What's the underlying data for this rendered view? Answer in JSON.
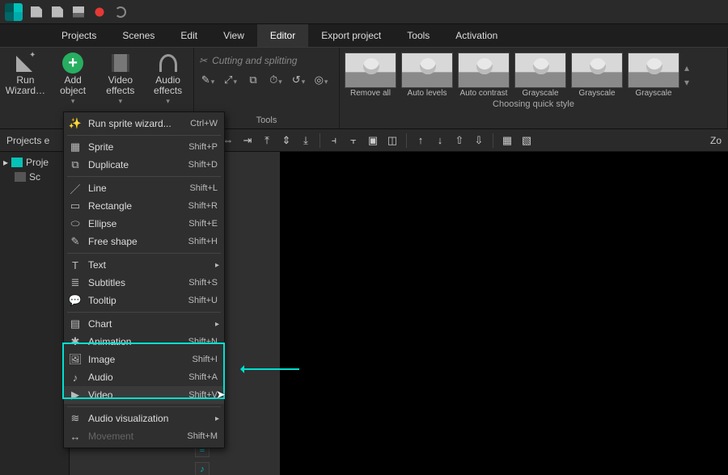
{
  "titlebar": {
    "icons": [
      "new-file-icon",
      "open-file-icon",
      "save-icon",
      "record-icon",
      "redo-icon"
    ]
  },
  "menubar": {
    "items": [
      "Projects",
      "Scenes",
      "Edit",
      "View",
      "Editor",
      "Export project",
      "Tools",
      "Activation"
    ],
    "active_index": 4
  },
  "ribbon": {
    "edit": {
      "run_wizard": "Run Wizard…",
      "add_object": "Add object",
      "video_effects": "Video effects",
      "audio_effects": "Audio effects"
    },
    "tools": {
      "top_label": "Cutting and splitting",
      "caption": "Tools"
    },
    "styles": {
      "caption": "Choosing quick style",
      "thumbs": [
        "Remove all",
        "Auto levels",
        "Auto contrast",
        "Grayscale",
        "Grayscale",
        "Grayscale"
      ]
    }
  },
  "panel_title": "Projects e",
  "tree": {
    "root": "Proje",
    "child": "Sc"
  },
  "toolbar2_zoom": "Zo",
  "ctx_menu": {
    "items": [
      {
        "icon": "wand-icon",
        "label": "Run sprite wizard...",
        "shortcut": "Ctrl+W",
        "interact": true
      },
      {
        "sep": true
      },
      {
        "icon": "sprite-icon",
        "label": "Sprite",
        "shortcut": "Shift+P",
        "interact": true
      },
      {
        "icon": "duplicate-icon",
        "label": "Duplicate",
        "shortcut": "Shift+D",
        "interact": true
      },
      {
        "sep": true
      },
      {
        "icon": "line-icon",
        "label": "Line",
        "shortcut": "Shift+L",
        "interact": true
      },
      {
        "icon": "rectangle-icon",
        "label": "Rectangle",
        "shortcut": "Shift+R",
        "interact": true
      },
      {
        "icon": "ellipse-icon",
        "label": "Ellipse",
        "shortcut": "Shift+E",
        "interact": true
      },
      {
        "icon": "freeshape-icon",
        "label": "Free shape",
        "shortcut": "Shift+H",
        "interact": true
      },
      {
        "sep": true
      },
      {
        "icon": "text-icon",
        "label": "Text",
        "submenu": true,
        "interact": true
      },
      {
        "icon": "subtitles-icon",
        "label": "Subtitles",
        "shortcut": "Shift+S",
        "interact": true
      },
      {
        "icon": "tooltip-icon",
        "label": "Tooltip",
        "shortcut": "Shift+U",
        "interact": true
      },
      {
        "sep": true
      },
      {
        "icon": "chart-icon",
        "label": "Chart",
        "submenu": true,
        "interact": true
      },
      {
        "icon": "animation-icon",
        "label": "Animation",
        "shortcut": "Shift+N",
        "interact": true
      },
      {
        "icon": "image-icon",
        "label": "Image",
        "shortcut": "Shift+I",
        "interact": true,
        "hl": true
      },
      {
        "icon": "audio-icon",
        "label": "Audio",
        "shortcut": "Shift+A",
        "interact": true,
        "hl": true
      },
      {
        "icon": "video-icon",
        "label": "Video",
        "shortcut": "Shift+V",
        "interact": true,
        "hl": true,
        "hover": true
      },
      {
        "sep": true
      },
      {
        "icon": "audiovis-icon",
        "label": "Audio visualization",
        "submenu": true,
        "interact": true
      },
      {
        "icon": "movement-icon",
        "label": "Movement",
        "shortcut": "Shift+M",
        "interact": false,
        "disabled": true
      }
    ]
  }
}
